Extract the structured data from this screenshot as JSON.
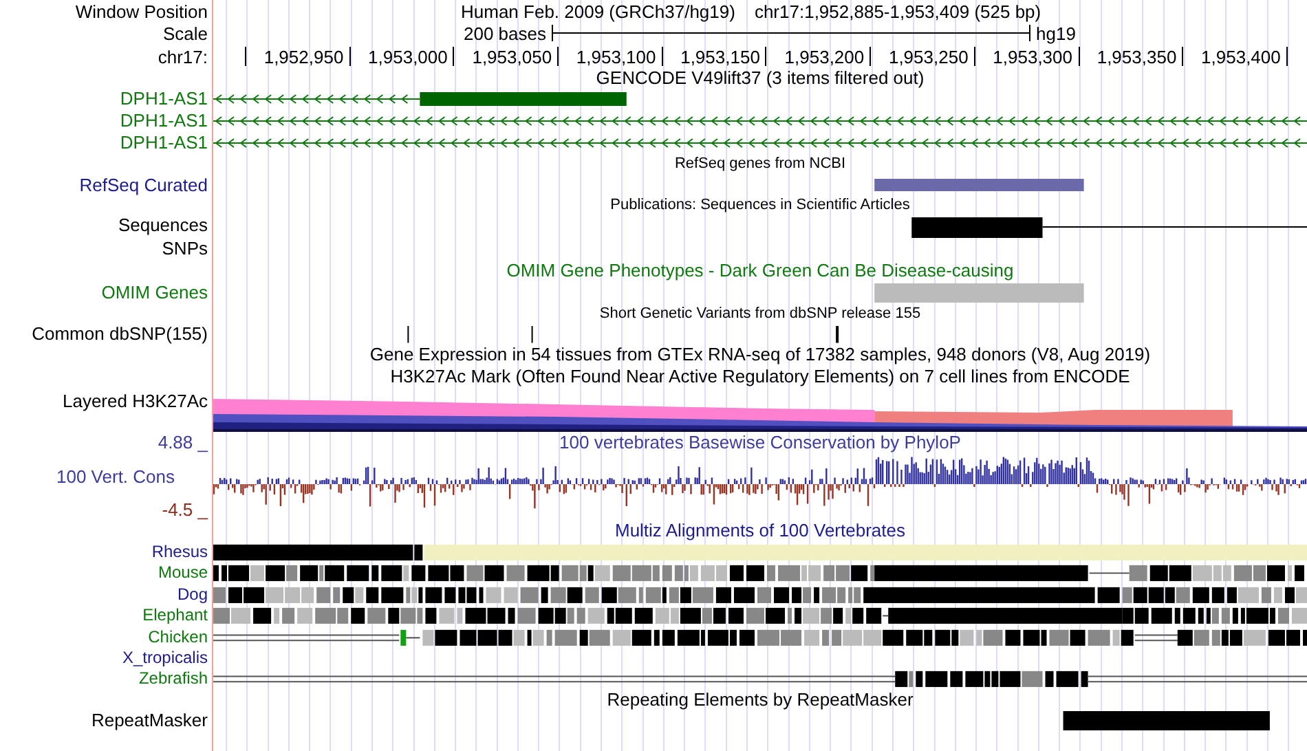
{
  "header": {
    "position_label": "Window Position",
    "assembly": "Human Feb. 2009 (GRCh37/hg19)",
    "range": "chr17:1,952,885-1,953,409 (525 bp)",
    "scale_label": "Scale",
    "scale_span": "200 bases",
    "database": "hg19",
    "chrom_label": "chr17:",
    "ticks": [
      "1,952,950",
      "1,953,000",
      "1,953,050",
      "1,953,100",
      "1,953,150",
      "1,953,200",
      "1,953,250",
      "1,953,300",
      "1,953,350",
      "1,953,400"
    ]
  },
  "tracks": [
    {
      "kind": "gencode",
      "title": "GENCODE V49lift37 (3 items filtered out)",
      "genes": [
        {
          "label": "DPH1-AS1",
          "color": "#0e7a0e"
        },
        {
          "label": "DPH1-AS1",
          "color": "#0e7a0e"
        },
        {
          "label": "DPH1-AS1",
          "color": "#0e7a0e"
        }
      ]
    },
    {
      "kind": "refseq",
      "title": "RefSeq genes from NCBI",
      "label": "RefSeq Curated",
      "color": "#1c1c8c"
    },
    {
      "kind": "publications",
      "title": "Publications: Sequences in Scientific Articles",
      "labels": [
        "Sequences",
        "SNPs"
      ]
    },
    {
      "kind": "omim",
      "title": "OMIM Gene Phenotypes - Dark Green Can Be Disease-causing",
      "label": "OMIM Genes",
      "color": "#0e7a0e"
    },
    {
      "kind": "dbsnp",
      "title": "Short Genetic Variants from dbSNP release 155",
      "label": "Common dbSNP(155)"
    },
    {
      "kind": "gtex",
      "title": "Gene Expression in 54 tissues from GTEx RNA-seq of 17382 samples, 948 donors (V8, Aug 2019)"
    },
    {
      "kind": "h3k27ac",
      "title": "H3K27Ac Mark (Often Found Near Active Regulatory Elements) on 7 cell lines from ENCODE",
      "label": "Layered H3K27Ac"
    },
    {
      "kind": "phylop",
      "title": "100 vertebrates Basewise Conservation by PhyloP",
      "label": "100 Vert. Cons",
      "max": "4.88 _",
      "min": "-4.5 _"
    },
    {
      "kind": "multiz",
      "title": "Multiz Alignments of 100 Vertebrates",
      "species": [
        {
          "label": "Rhesus",
          "color": "#1c1c8c"
        },
        {
          "label": "Mouse",
          "color": "#0e7a0e"
        },
        {
          "label": "Dog",
          "color": "#1c1c8c"
        },
        {
          "label": "Elephant",
          "color": "#0e7a0e"
        },
        {
          "label": "Chicken",
          "color": "#0e7a0e"
        },
        {
          "label": "X_tropicalis",
          "color": "#1c1c8c"
        },
        {
          "label": "Zebrafish",
          "color": "#0e7a0e"
        }
      ]
    },
    {
      "kind": "repeatmasker",
      "title": "Repeating Elements by RepeatMasker",
      "label": "RepeatMasker"
    }
  ]
}
